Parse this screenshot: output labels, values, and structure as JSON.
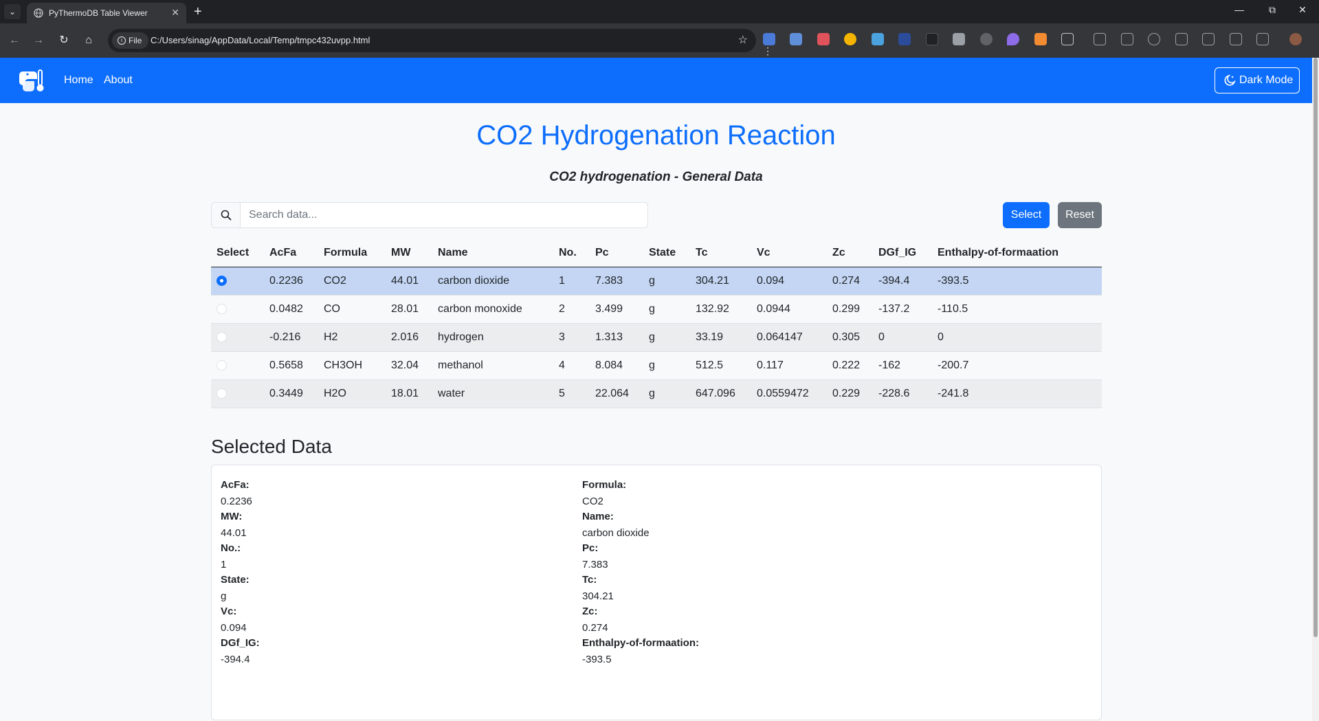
{
  "browser": {
    "tab_title": "PyThermoDB Table Viewer",
    "site_chip": "File",
    "url": "C:/Users/sinag/AppData/Local/Temp/tmpc432uvpp.html"
  },
  "nav": {
    "links": [
      "Home",
      "About"
    ],
    "dark_mode_label": "Dark Mode"
  },
  "main": {
    "title": "CO2 Hydrogenation Reaction",
    "subtitle": "CO2 hydrogenation - General Data",
    "search_placeholder": "Search data...",
    "select_label": "Select",
    "reset_label": "Reset"
  },
  "table": {
    "columns": [
      "Select",
      "AcFa",
      "Formula",
      "MW",
      "Name",
      "No.",
      "Pc",
      "State",
      "Tc",
      "Vc",
      "Zc",
      "DGf_IG",
      "Enthalpy-of-formaation"
    ],
    "rows": [
      {
        "selected": true,
        "cells": [
          "0.2236",
          "CO2",
          "44.01",
          "carbon dioxide",
          "1",
          "7.383",
          "g",
          "304.21",
          "0.094",
          "0.274",
          "-394.4",
          "-393.5"
        ]
      },
      {
        "selected": false,
        "cells": [
          "0.0482",
          "CO",
          "28.01",
          "carbon monoxide",
          "2",
          "3.499",
          "g",
          "132.92",
          "0.0944",
          "0.299",
          "-137.2",
          "-110.5"
        ]
      },
      {
        "selected": false,
        "cells": [
          "-0.216",
          "H2",
          "2.016",
          "hydrogen",
          "3",
          "1.313",
          "g",
          "33.19",
          "0.064147",
          "0.305",
          "0",
          "0"
        ]
      },
      {
        "selected": false,
        "cells": [
          "0.5658",
          "CH3OH",
          "32.04",
          "methanol",
          "4",
          "8.084",
          "g",
          "512.5",
          "0.117",
          "0.222",
          "-162",
          "-200.7"
        ]
      },
      {
        "selected": false,
        "cells": [
          "0.3449",
          "H2O",
          "18.01",
          "water",
          "5",
          "22.064",
          "g",
          "647.096",
          "0.0559472",
          "0.229",
          "-228.6",
          "-241.8"
        ]
      }
    ]
  },
  "selected": {
    "title": "Selected Data",
    "fields": [
      {
        "label": "AcFa:",
        "value": "0.2236"
      },
      {
        "label": "Formula:",
        "value": "CO2"
      },
      {
        "label": "MW:",
        "value": "44.01"
      },
      {
        "label": "Name:",
        "value": "carbon dioxide"
      },
      {
        "label": "No.:",
        "value": "1"
      },
      {
        "label": "Pc:",
        "value": "7.383"
      },
      {
        "label": "State:",
        "value": "g"
      },
      {
        "label": "Tc:",
        "value": "304.21"
      },
      {
        "label": "Vc:",
        "value": "0.094"
      },
      {
        "label": "Zc:",
        "value": "0.274"
      },
      {
        "label": "DGf_IG:",
        "value": "-394.4"
      },
      {
        "label": "Enthalpy-of-formaation:",
        "value": "-393.5"
      }
    ]
  }
}
